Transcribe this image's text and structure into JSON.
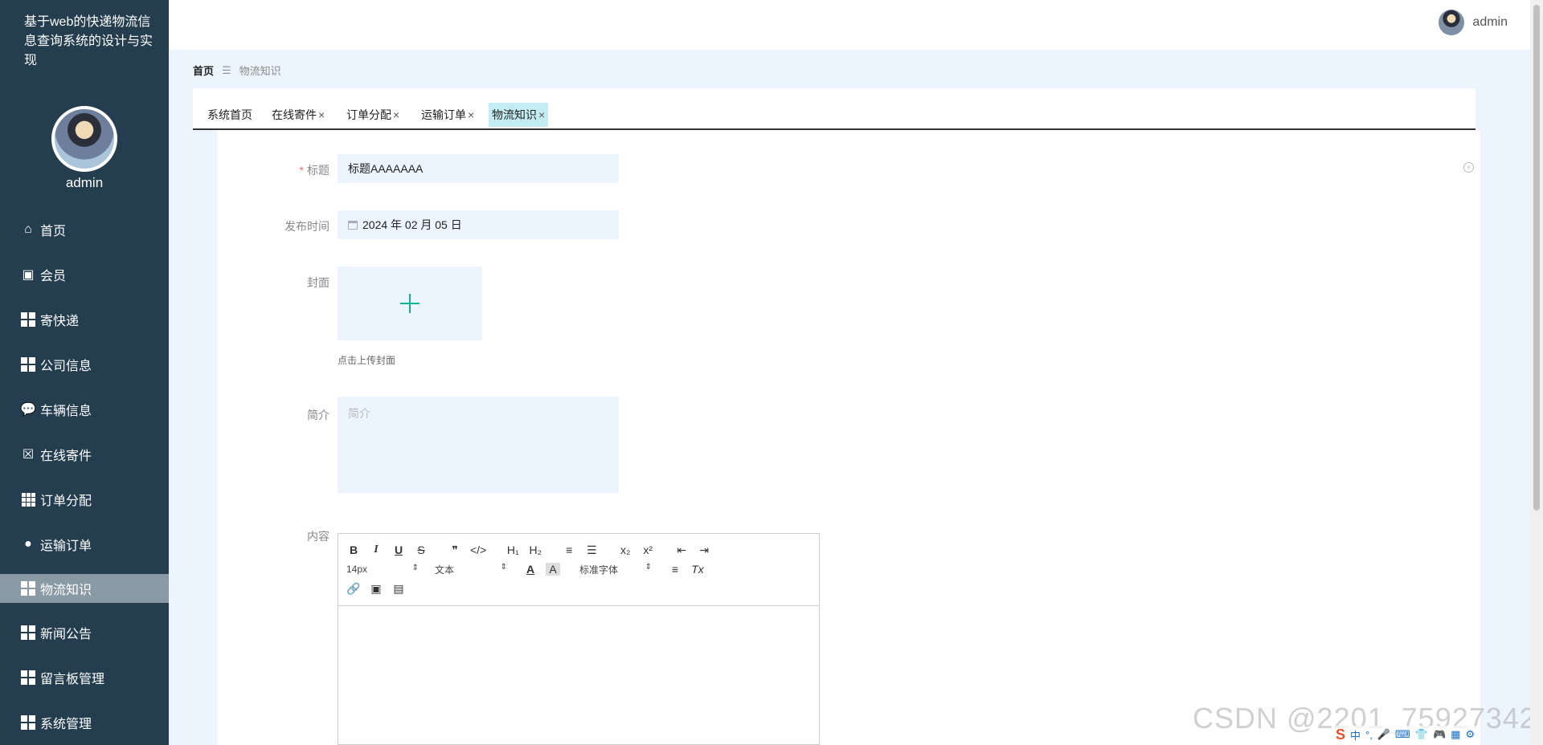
{
  "app": {
    "title": "基于web的快递物流信息查询系统的设计与实现"
  },
  "sidebar": {
    "username": "admin",
    "items": [
      {
        "label": "首页",
        "icon": "home-icon"
      },
      {
        "label": "会员",
        "icon": "wallet-icon"
      },
      {
        "label": "寄快递",
        "icon": "grid-icon"
      },
      {
        "label": "公司信息",
        "icon": "grid-icon"
      },
      {
        "label": "车辆信息",
        "icon": "chat-icon"
      },
      {
        "label": "在线寄件",
        "icon": "clipboard-icon"
      },
      {
        "label": "订单分配",
        "icon": "grid9-icon"
      },
      {
        "label": "运输订单",
        "icon": "bulb-icon"
      },
      {
        "label": "物流知识",
        "icon": "grid-icon",
        "active": true
      },
      {
        "label": "新闻公告",
        "icon": "grid-icon"
      },
      {
        "label": "留言板管理",
        "icon": "grid-icon"
      },
      {
        "label": "系统管理",
        "icon": "grid-icon"
      }
    ]
  },
  "header": {
    "username": "admin"
  },
  "breadcrumb": {
    "home": "首页",
    "separator": "☰",
    "current": "物流知识"
  },
  "tabs": [
    {
      "label": "系统首页",
      "closable": false
    },
    {
      "label": "在线寄件",
      "closable": true
    },
    {
      "label": "订单分配",
      "closable": true
    },
    {
      "label": "运输订单",
      "closable": true
    },
    {
      "label": "物流知识",
      "closable": true,
      "active": true
    }
  ],
  "tab_close_glyph": "×",
  "form": {
    "title_label": "标题",
    "required_mark": "*",
    "title_value": "标题AAAAAAA",
    "date_label": "发布时间",
    "date_value": "2024 年 02 月 05 日",
    "cover_label": "封面",
    "cover_tip": "点击上传封面",
    "summary_label": "简介",
    "summary_placeholder": "简介",
    "content_label": "内容",
    "clear_glyph": "×"
  },
  "editor": {
    "row1": [
      "B",
      "I",
      "U",
      "S",
      "❞",
      "</>",
      "H₁",
      "H₂",
      "≡",
      "☰",
      "x₂",
      "x²",
      "⇤",
      "⇥"
    ],
    "font_size": "14px",
    "format": "文本",
    "font_family": "标准字体",
    "color_glyph": "A",
    "bg_glyph": "A",
    "align_glyph": "≡",
    "clear_format_glyph": "Tx",
    "row3": [
      "🔗",
      "▣",
      "▤"
    ],
    "select_arrow": "⇕"
  },
  "watermark": "CSDN @2201_75927342",
  "tray": {
    "logo": "S",
    "items": [
      "中",
      "°,",
      "🎤",
      "⌨",
      "👕",
      "🎮",
      "▦",
      "⚙"
    ]
  },
  "colors": {
    "sidebar": "#243d4f",
    "active_tab": "#c4ecf3",
    "accent": "#0fb39a",
    "field_bg": "#ecf5fd"
  }
}
